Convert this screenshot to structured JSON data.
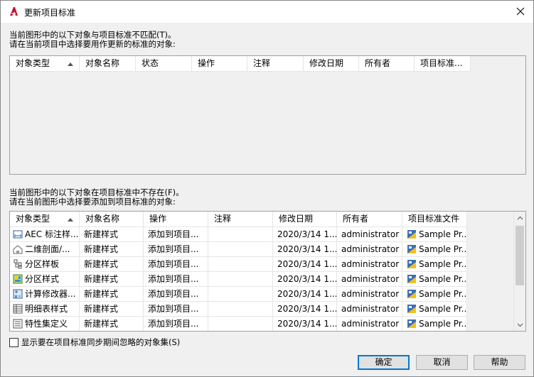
{
  "window": {
    "title": "更新项目标准"
  },
  "top": {
    "line1": "当前图形中的以下对象与项目标准不匹配(T)。",
    "line2": "请在当前项目中选择要用作更新的标准的对象:",
    "columns": [
      "对象类型",
      "对象名称",
      "状态",
      "操作",
      "注释",
      "修改日期",
      "所有者",
      "项目标准..."
    ]
  },
  "bottom": {
    "line1": "当前图形中的以下对象在项目标准中不存在(F)。",
    "line2": "请在当前图形中选择要添加到项目标准的对象:",
    "columns": [
      "对象类型",
      "对象名称",
      "操作",
      "注释",
      "修改日期",
      "所有者",
      "项目标准文件"
    ],
    "rows": [
      {
        "icon": "dimension-style-icon",
        "type": "AEC 标注样...",
        "name": "新建样式",
        "action": "添加到项目...",
        "note": "",
        "date": "2020/3/14 1...",
        "owner": "administrator",
        "file": "Sample Pr..."
      },
      {
        "icon": "section-elevation-icon",
        "type": "二维剖面/...",
        "name": "新建样式",
        "action": "添加到项目...",
        "note": "",
        "date": "2020/3/14 1...",
        "owner": "administrator",
        "file": "Sample Pr..."
      },
      {
        "icon": "zone-template-icon",
        "type": "分区样板",
        "name": "新建样式",
        "action": "添加到项目...",
        "note": "",
        "date": "2020/3/14 1...",
        "owner": "administrator",
        "file": "Sample Pr..."
      },
      {
        "icon": "zone-style-icon",
        "type": "分区样式",
        "name": "新建样式",
        "action": "添加到项目...",
        "note": "",
        "date": "2020/3/14 1...",
        "owner": "administrator",
        "file": "Sample Pr..."
      },
      {
        "icon": "calculation-modifier-icon",
        "type": "计算修改器...",
        "name": "新建样式",
        "action": "添加到项目...",
        "note": "",
        "date": "2020/3/14 1...",
        "owner": "administrator",
        "file": "Sample Pr..."
      },
      {
        "icon": "schedule-table-icon",
        "type": "明细表样式",
        "name": "新建样式",
        "action": "添加到项目...",
        "note": "",
        "date": "2020/3/14 1...",
        "owner": "administrator",
        "file": "Sample Pr..."
      },
      {
        "icon": "property-set-icon",
        "type": "特性集定义",
        "name": "新建样式",
        "action": "添加到项目...",
        "note": "",
        "date": "2020/3/14 1...",
        "owner": "administrator",
        "file": "Sample Pr..."
      }
    ]
  },
  "checkbox_label": "显示要在项目标准同步期间忽略的对象集(S)",
  "buttons": {
    "ok": "确定",
    "cancel": "取消",
    "help": "帮助"
  },
  "colors": {
    "accent": "#0078d7",
    "app_icon": "#c8102e"
  }
}
